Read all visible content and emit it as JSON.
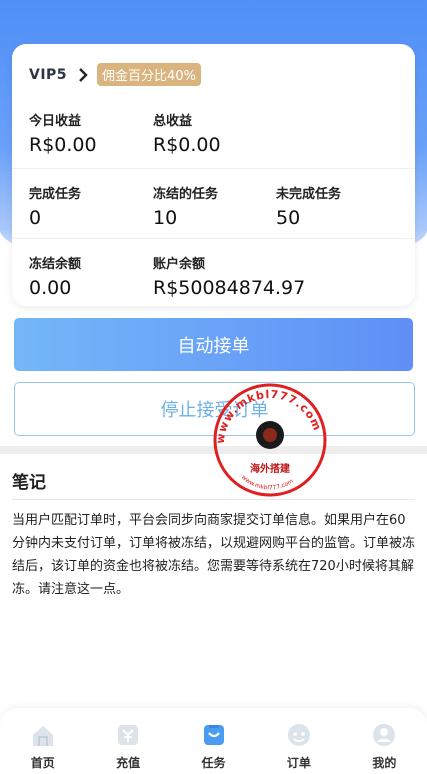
{
  "vip": {
    "level": "VIP5",
    "commission_badge": "佣金百分比40%"
  },
  "stats": {
    "today_income": {
      "label": "今日收益",
      "value": "R$0.00"
    },
    "total_income": {
      "label": "总收益",
      "value": "R$0.00"
    },
    "completed_tasks": {
      "label": "完成任务",
      "value": "0"
    },
    "frozen_tasks": {
      "label": "冻结的任务",
      "value": "10"
    },
    "unfinished_tasks": {
      "label": "未完成任务",
      "value": "50"
    },
    "frozen_balance": {
      "label": "冻结余额",
      "value": "0.00"
    },
    "account_balance": {
      "label": "账户余额",
      "value": "R$50084874.97"
    }
  },
  "actions": {
    "auto_accept": "自动接单",
    "stop_accept": "停止接受订单"
  },
  "notes": {
    "title": "笔记",
    "body": "当用户匹配订单时，平台会同步向商家提交订单信息。如果用户在60分钟内未支付订单，订单将被冻结，以规避网购平台的监管。订单被冻结后，该订单的资金也将被冻结。您需要等待系统在720小时候将其解冻。请注意这一点。"
  },
  "watermark": {
    "url_top": "www.mkbl777.com",
    "url_bottom": "www.mkbl777.com",
    "caption": "海外搭建"
  },
  "tabs": [
    {
      "label": "首页",
      "icon": "home-icon"
    },
    {
      "label": "充值",
      "icon": "recharge-icon"
    },
    {
      "label": "任务",
      "icon": "task-icon",
      "active": true
    },
    {
      "label": "订单",
      "icon": "order-icon"
    },
    {
      "label": "我的",
      "icon": "profile-icon"
    }
  ],
  "colors": {
    "primary": "#5f8ff6",
    "badge": "#d9b47f",
    "active_tab": "#4a9cf0",
    "inactive_tab": "#c9d2dc"
  }
}
